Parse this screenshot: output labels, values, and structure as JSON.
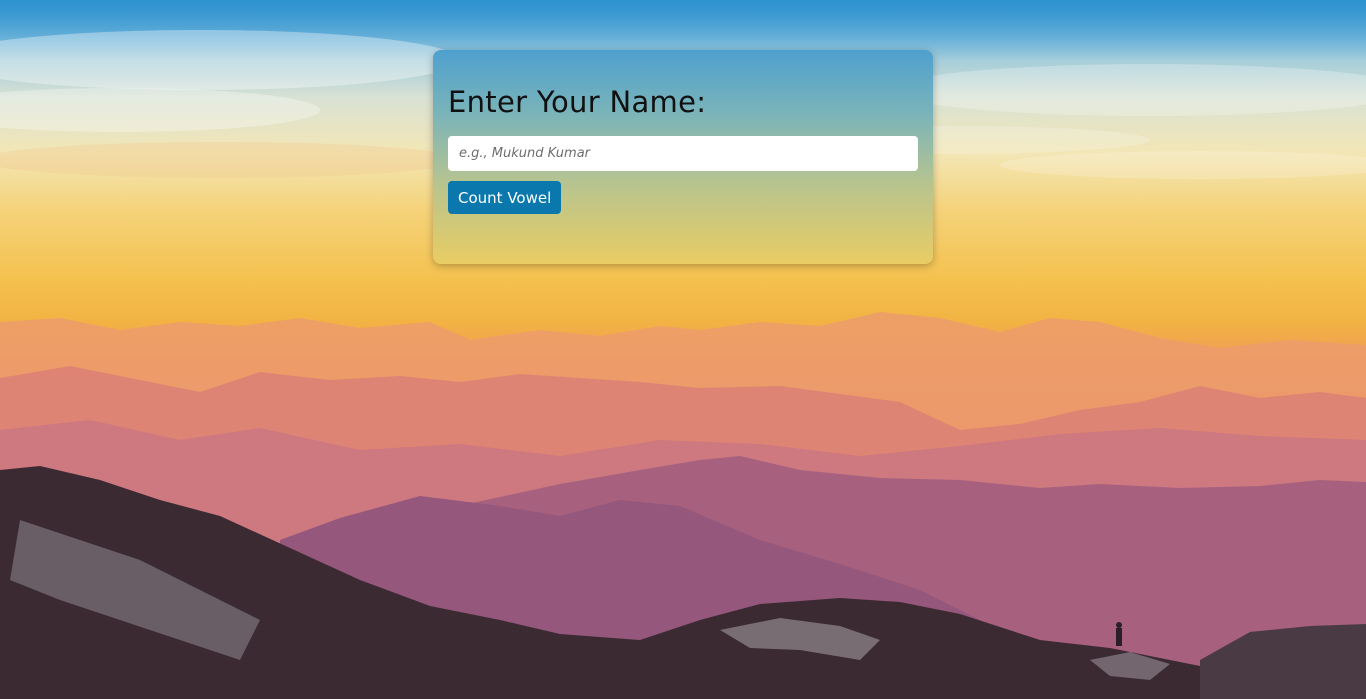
{
  "form": {
    "title": "Enter Your Name:",
    "input_placeholder": "e.g., Mukund Kumar",
    "input_value": "",
    "button_label": "Count Vowel"
  },
  "colors": {
    "button_bg": "#0a78ad",
    "button_text": "#ffffff",
    "card_top": "#4ea0cf",
    "card_bottom": "#e9cc63"
  }
}
